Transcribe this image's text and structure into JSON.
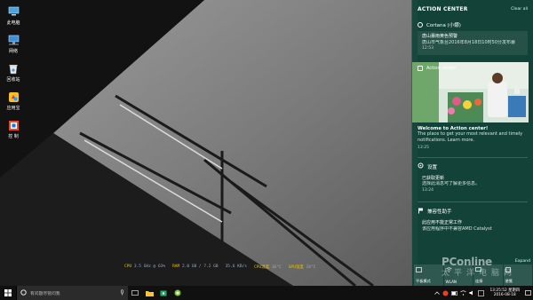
{
  "desktop": {
    "icons": [
      {
        "name": "this-pc-icon",
        "label": "此电脑"
      },
      {
        "name": "network-icon",
        "label": "网络"
      },
      {
        "name": "recycle-bin-icon",
        "label": "回收站"
      },
      {
        "name": "app-store-icon",
        "label": "应用宝"
      },
      {
        "name": "control-icon",
        "label": "控 制"
      }
    ]
  },
  "perf": {
    "cpu_label": "CPU",
    "cpu_value": "3.5 GHz @ 63%",
    "ram_label": "RAM",
    "ram_value": "2.0 GB / 7.2 GB",
    "net_value": "35.6 KB/s",
    "cpu_temp_label": "CPU温度",
    "cpu_temp_value": "36°C",
    "gpu_temp_label": "GPU温度",
    "gpu_temp_value": "28°C"
  },
  "taskbar": {
    "search_placeholder": "有问题尽管问我",
    "clock_time": "13:25:52 星期四",
    "clock_date": "2016-08-18"
  },
  "action_center": {
    "title": "ACTION CENTER",
    "clear_all": "Clear all",
    "cortana": {
      "app_name": "Cortana (小娜)",
      "item_title": "唐山暴雨黄色预警",
      "item_body": "唐山市气象台2016年8月18日10时50分发布暴",
      "time": "12:53"
    },
    "promo": {
      "label": "Action center",
      "headline": "Welcome to Action center!",
      "body": "The place to get your most relevant and timely notifications. Learn more.",
      "time": "13:25"
    },
    "settings": {
      "app_name": "设置",
      "item_title": "已获取更新",
      "item_body": "选择此消息可了解更多信息。",
      "time": "13:24"
    },
    "tips": {
      "app_name": "兼容性助手",
      "item_title": "此应用不能正常工作",
      "item_body": "该应用程序中不兼容AMD Catalyst",
      "time": "..."
    },
    "expand": "Expand",
    "quick_actions": [
      {
        "label": "平板模式"
      },
      {
        "label": "WLAN"
      },
      {
        "label": "连接"
      },
      {
        "label": "便笺"
      }
    ]
  },
  "watermark": {
    "brand": "PConline",
    "sub": "太平洋电脑网"
  }
}
